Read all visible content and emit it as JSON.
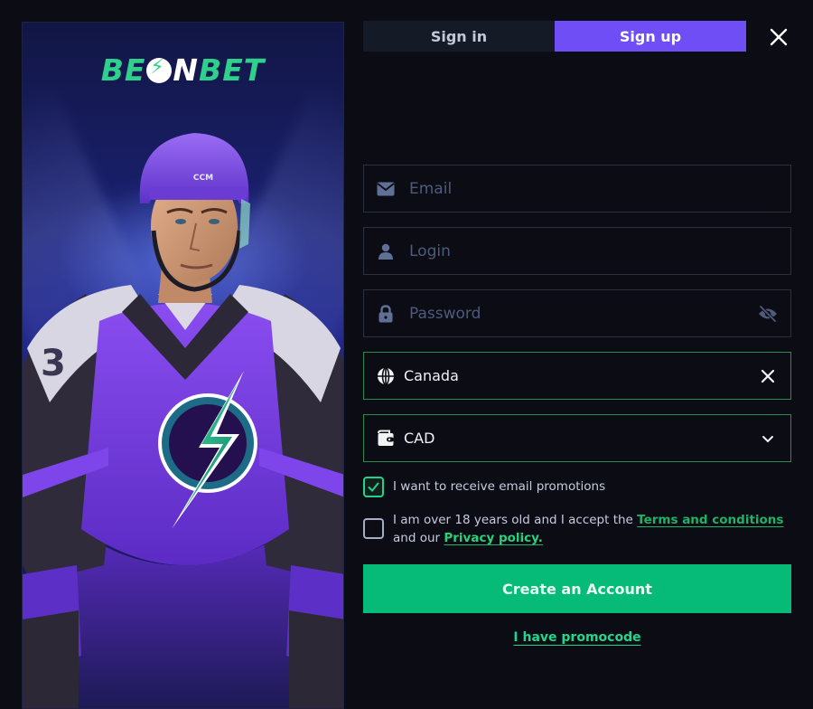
{
  "brand": {
    "logo_prefix": "BE",
    "logo_n": "N",
    "logo_suffix": "BET",
    "accent": "#2fd08c"
  },
  "tabs": [
    {
      "label": "Sign in",
      "active": false
    },
    {
      "label": "Sign up",
      "active": true
    }
  ],
  "close": {
    "icon": "close-icon"
  },
  "form": {
    "email": {
      "placeholder": "Email",
      "value": "",
      "icon": "envelope-icon"
    },
    "login": {
      "placeholder": "Login",
      "value": "",
      "icon": "user-icon"
    },
    "password": {
      "placeholder": "Password",
      "value": "",
      "icon": "lock-icon",
      "toggle_icon": "eye-slash-icon"
    },
    "country": {
      "value": "Canada",
      "icon": "globe-icon",
      "clear_icon": "close-icon"
    },
    "currency": {
      "value": "CAD",
      "icon": "wallet-icon",
      "dropdown_icon": "chevron-down-icon"
    }
  },
  "checkboxes": {
    "promotions": {
      "checked": true,
      "label": "I want to receive email promotions"
    },
    "terms": {
      "checked": false,
      "text_before": "I am over 18 years old and I accept the ",
      "terms_link": "Terms and conditions",
      "text_middle": " and our ",
      "privacy_link": "Privacy policy."
    }
  },
  "buttons": {
    "create_account": "Create an Account",
    "promocode": "I have promocode"
  },
  "colors": {
    "tab_active": "#6f4ef6",
    "primary_button": "#06bb78",
    "valid_border": "#2c8a4f",
    "link": "#1fb266"
  }
}
